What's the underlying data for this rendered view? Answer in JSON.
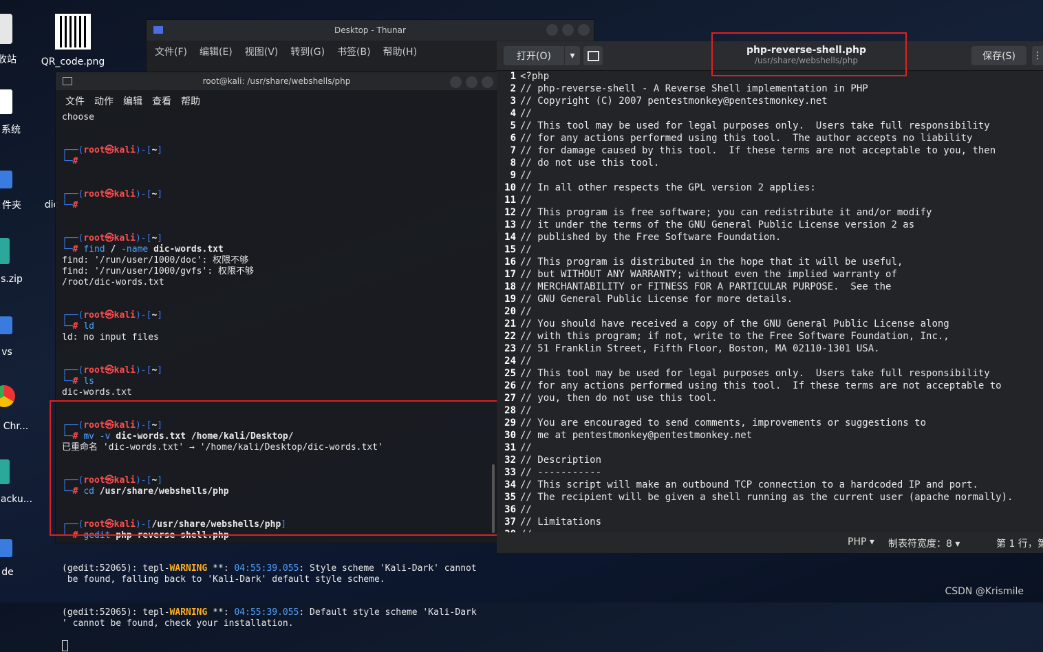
{
  "desktop": {
    "icons": [
      {
        "label": "收站",
        "kind": "trash"
      },
      {
        "label": "QR_code.png",
        "kind": "qr"
      },
      {
        "label": "系统",
        "kind": "disk"
      },
      {
        "label": "件夹",
        "kind": "folder"
      },
      {
        "label": "dic",
        "kind": "file"
      },
      {
        "label": "s.zip",
        "kind": "archive"
      },
      {
        "label": "vs",
        "kind": "folder"
      },
      {
        "label": "Chr...",
        "kind": "chrome"
      },
      {
        "label": "acku...",
        "kind": "archive"
      },
      {
        "label": "de",
        "kind": "folder"
      }
    ],
    "watermark": "CSDN @Krismile"
  },
  "thunar": {
    "title": "Desktop - Thunar",
    "menu": [
      "文件(F)",
      "编辑(E)",
      "视图(V)",
      "转到(G)",
      "书签(B)",
      "帮助(H)"
    ]
  },
  "terminal": {
    "title": "root@kali: /usr/share/webshells/php",
    "menu": [
      "文件",
      "动作",
      "编辑",
      "查看",
      "帮助"
    ],
    "top_line": "choose",
    "prompt": {
      "user": "root",
      "at": "㉿",
      "host": "kali",
      "home": "~"
    },
    "find": {
      "cmd": "find",
      "a1": "/",
      "a2": "-name",
      "a3": "dic-words.txt",
      "out": [
        "find: '/run/user/1000/doc': 权限不够",
        "find: '/run/user/1000/gvfs': 权限不够",
        "/root/dic-words.txt"
      ]
    },
    "ld": {
      "cmd": "ld",
      "out": "ld: no input files"
    },
    "ls": {
      "cmd": "ls",
      "out": "dic-words.txt"
    },
    "mv": {
      "cmd": "mv",
      "a1": "-v",
      "a2": "dic-words.txt /home/kali/Desktop/",
      "out": "已重命名 'dic-words.txt' → '/home/kali/Desktop/dic-words.txt'"
    },
    "cd": {
      "cmd": "cd",
      "a1": "/usr/share/webshells/php"
    },
    "gedit": {
      "path": "/usr/share/webshells/php",
      "cmd": "gedit",
      "a1": "php-reverse-shell.php"
    },
    "warnings": [
      {
        "pre": "(gedit:52065): tepl-",
        "warn": "WARNING",
        "mid": " **: ",
        "ts": "04:55:39.055",
        "post": ": Style scheme 'Kali-Dark' cannot",
        "line2": " be found, falling back to 'Kali-Dark' default style scheme."
      },
      {
        "pre": "(gedit:52065): tepl-",
        "warn": "WARNING",
        "mid": " **: ",
        "ts": "04:55:39.055",
        "post": ": Default style scheme 'Kali-Dark",
        "line2": "' cannot be found, check your installation."
      }
    ]
  },
  "gedit": {
    "open_label": "打开(O)",
    "save_label": "保存(S)",
    "file_name": "php-reverse-shell.php",
    "file_path": "/usr/share/webshells/php",
    "lines": [
      "<?php",
      "// php-reverse-shell - A Reverse Shell implementation in PHP",
      "// Copyright (C) 2007 pentestmonkey@pentestmonkey.net",
      "//",
      "// This tool may be used for legal purposes only.  Users take full responsibility",
      "// for any actions performed using this tool.  The author accepts no liability",
      "// for damage caused by this tool.  If these terms are not acceptable to you, then",
      "// do not use this tool.",
      "//",
      "// In all other respects the GPL version 2 applies:",
      "//",
      "// This program is free software; you can redistribute it and/or modify",
      "// it under the terms of the GNU General Public License version 2 as",
      "// published by the Free Software Foundation.",
      "//",
      "// This program is distributed in the hope that it will be useful,",
      "// but WITHOUT ANY WARRANTY; without even the implied warranty of",
      "// MERCHANTABILITY or FITNESS FOR A PARTICULAR PURPOSE.  See the",
      "// GNU General Public License for more details.",
      "//",
      "// You should have received a copy of the GNU General Public License along",
      "// with this program; if not, write to the Free Software Foundation, Inc.,",
      "// 51 Franklin Street, Fifth Floor, Boston, MA 02110-1301 USA.",
      "//",
      "// This tool may be used for legal purposes only.  Users take full responsibility",
      "// for any actions performed using this tool.  If these terms are not acceptable to",
      "// you, then do not use this tool.",
      "//",
      "// You are encouraged to send comments, improvements or suggestions to",
      "// me at pentestmonkey@pentestmonkey.net",
      "//",
      "// Description",
      "// -----------",
      "// This script will make an outbound TCP connection to a hardcoded IP and port.",
      "// The recipient will be given a shell running as the current user (apache normally).",
      "//",
      "// Limitations",
      "// -----------"
    ],
    "status": {
      "language": "PHP",
      "tab_width": "制表符宽度：8",
      "position": "第 1 行，第"
    }
  }
}
